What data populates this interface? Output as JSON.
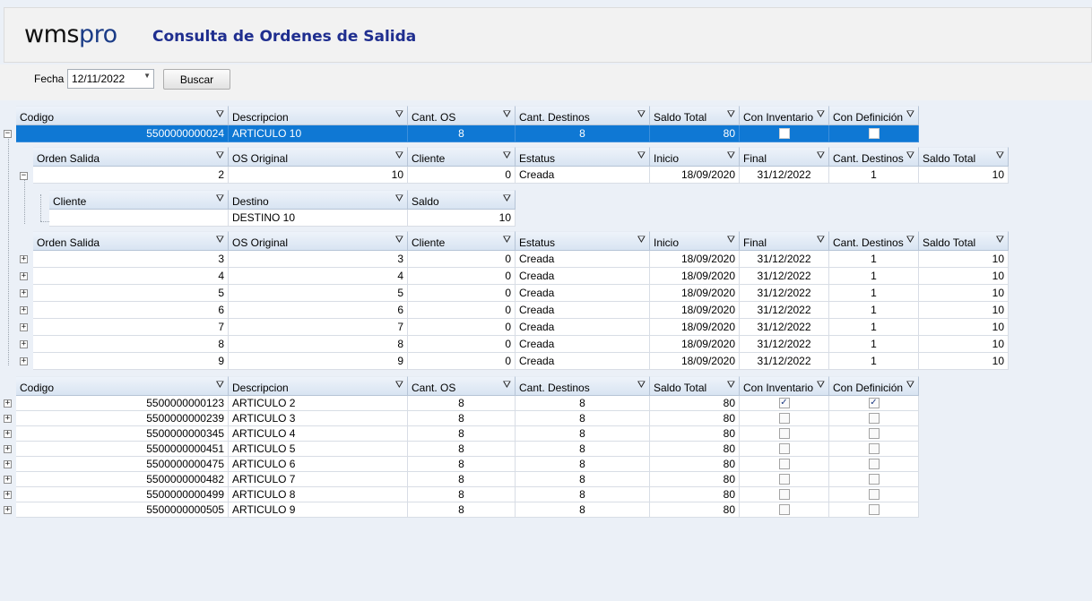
{
  "app": {
    "logo_text": "wms",
    "logo_accent": "pro",
    "title": "Consulta de Ordenes de Salida"
  },
  "filter": {
    "fecha_label": "Fecha",
    "fecha_value": "12/11/2022",
    "buscar_label": "Buscar"
  },
  "master_columns": [
    "Codigo",
    "Descripcion",
    "Cant. OS",
    "Cant. Destinos",
    "Saldo Total",
    "Con Inventario",
    "Con Definición"
  ],
  "orden_columns": [
    "Orden Salida",
    "OS Original",
    "Cliente",
    "Estatus",
    "Inicio",
    "Final",
    "Cant. Destinos",
    "Saldo Total"
  ],
  "destino_columns": [
    "Cliente",
    "Destino",
    "Saldo"
  ],
  "selected_article": {
    "codigo": "5500000000024",
    "descripcion": "ARTICULO 10",
    "cant_os": "8",
    "cant_destinos": "8",
    "saldo_total": "80",
    "con_inventario": false,
    "con_definicion": false
  },
  "expanded_order": {
    "orden_salida": "2",
    "os_original": "10",
    "cliente": "0",
    "estatus": "Creada",
    "inicio": "18/09/2020",
    "final": "31/12/2022",
    "cant_destinos": "1",
    "saldo_total": "10"
  },
  "destino_row": {
    "cliente": "",
    "destino": "DESTINO 10",
    "saldo": "10"
  },
  "other_orders": [
    {
      "orden_salida": "3",
      "os_original": "3",
      "cliente": "0",
      "estatus": "Creada",
      "inicio": "18/09/2020",
      "final": "31/12/2022",
      "cant_destinos": "1",
      "saldo_total": "10"
    },
    {
      "orden_salida": "4",
      "os_original": "4",
      "cliente": "0",
      "estatus": "Creada",
      "inicio": "18/09/2020",
      "final": "31/12/2022",
      "cant_destinos": "1",
      "saldo_total": "10"
    },
    {
      "orden_salida": "5",
      "os_original": "5",
      "cliente": "0",
      "estatus": "Creada",
      "inicio": "18/09/2020",
      "final": "31/12/2022",
      "cant_destinos": "1",
      "saldo_total": "10"
    },
    {
      "orden_salida": "6",
      "os_original": "6",
      "cliente": "0",
      "estatus": "Creada",
      "inicio": "18/09/2020",
      "final": "31/12/2022",
      "cant_destinos": "1",
      "saldo_total": "10"
    },
    {
      "orden_salida": "7",
      "os_original": "7",
      "cliente": "0",
      "estatus": "Creada",
      "inicio": "18/09/2020",
      "final": "31/12/2022",
      "cant_destinos": "1",
      "saldo_total": "10"
    },
    {
      "orden_salida": "8",
      "os_original": "8",
      "cliente": "0",
      "estatus": "Creada",
      "inicio": "18/09/2020",
      "final": "31/12/2022",
      "cant_destinos": "1",
      "saldo_total": "10"
    },
    {
      "orden_salida": "9",
      "os_original": "9",
      "cliente": "0",
      "estatus": "Creada",
      "inicio": "18/09/2020",
      "final": "31/12/2022",
      "cant_destinos": "1",
      "saldo_total": "10"
    }
  ],
  "other_articles": [
    {
      "codigo": "5500000000123",
      "descripcion": "ARTICULO 2",
      "cant_os": "8",
      "cant_destinos": "8",
      "saldo_total": "80",
      "con_inventario": true,
      "con_definicion": true
    },
    {
      "codigo": "5500000000239",
      "descripcion": "ARTICULO 3",
      "cant_os": "8",
      "cant_destinos": "8",
      "saldo_total": "80",
      "con_inventario": false,
      "con_definicion": false
    },
    {
      "codigo": "5500000000345",
      "descripcion": "ARTICULO 4",
      "cant_os": "8",
      "cant_destinos": "8",
      "saldo_total": "80",
      "con_inventario": false,
      "con_definicion": false
    },
    {
      "codigo": "5500000000451",
      "descripcion": "ARTICULO 5",
      "cant_os": "8",
      "cant_destinos": "8",
      "saldo_total": "80",
      "con_inventario": false,
      "con_definicion": false
    },
    {
      "codigo": "5500000000475",
      "descripcion": "ARTICULO 6",
      "cant_os": "8",
      "cant_destinos": "8",
      "saldo_total": "80",
      "con_inventario": false,
      "con_definicion": false
    },
    {
      "codigo": "5500000000482",
      "descripcion": "ARTICULO 7",
      "cant_os": "8",
      "cant_destinos": "8",
      "saldo_total": "80",
      "con_inventario": false,
      "con_definicion": false
    },
    {
      "codigo": "5500000000499",
      "descripcion": "ARTICULO 8",
      "cant_os": "8",
      "cant_destinos": "8",
      "saldo_total": "80",
      "con_inventario": false,
      "con_definicion": false
    },
    {
      "codigo": "5500000000505",
      "descripcion": "ARTICULO 9",
      "cant_os": "8",
      "cant_destinos": "8",
      "saldo_total": "80",
      "con_inventario": false,
      "con_definicion": false
    }
  ],
  "icons": {
    "filter": "filter-icon",
    "expand": "expand-icon",
    "collapse": "collapse-icon",
    "date_dropdown": "chevron-down-icon"
  },
  "colors": {
    "selection": "#0f78d4",
    "title": "#1f2e8f",
    "background": "#ebf0f7"
  }
}
